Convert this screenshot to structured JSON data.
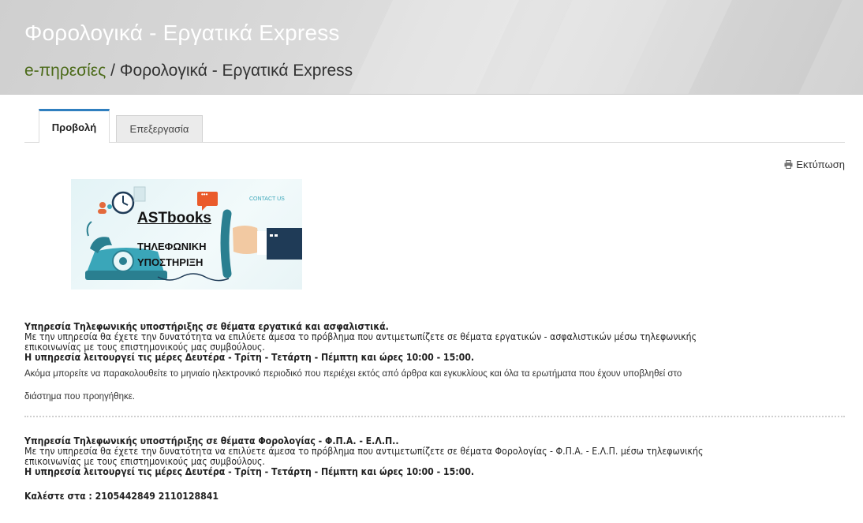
{
  "header": {
    "title": "Φορολογικά - Εργατικά Express",
    "breadcrumb": {
      "link": "e-πηρεσίες",
      "separator": "/",
      "current": "Φορολογικά - Εργατικά Express"
    }
  },
  "tabs": [
    {
      "label": "Προβολή",
      "active": true
    },
    {
      "label": "Επεξεργασία",
      "active": false
    }
  ],
  "print_label": "Εκτύπωση",
  "promo_image": {
    "contact_text": "CONTACT US",
    "brand": "ASTbooks",
    "line1": "ΤΗΛΕΦΩΝΙΚΗ",
    "line2": "ΥΠΟΣΤΗΡΙΞΗ",
    "badge": "•••"
  },
  "section1": {
    "heading": "Υπηρεσία Τηλεφωνικής υποστήριξης σε θέματα εργατικά και ασφαλιστικά.",
    "line1": "Με την υπηρεσία θα έχετε την δυνατότητα να επιλύετε άμεσα το πρόβλημα που αντιμετωπίζετε σε θέματα εργατικών - ασφαλιστικών μέσω τηλεφωνικής",
    "line2": "επικοινωνίας με τους επιστημονικούς μας συμβούλους.",
    "hours": "Η υπηρεσία λειτουργεί τις μέρες Δευτέρα - Τρίτη - Τετάρτη - Πέμπτη και ώρες 10:00 - 15:00.",
    "extra1": "Ακόμα μπορείτε να παρακολουθείτε το μηνιαίο ηλεκτρονικό περιοδικό που περιέχει εκτός από άρθρα και εγκυκλίους και όλα τα ερωτήματα που έχουν υποβληθεί στο",
    "extra2": "διάστημα που προηγήθηκε."
  },
  "section2": {
    "heading": "Υπηρεσία Τηλεφωνικής υποστήριξης σε θέματα Φορολογίας - Φ.Π.Α. - Ε.Λ.Π..",
    "line1": "Με την υπηρεσία θα έχετε την δυνατότητα να επιλύετε άμεσα το πρόβλημα που αντιμετωπίζετε σε θέματα Φορολογίας - Φ.Π.Α. - Ε.Λ.Π. μέσω τηλεφωνικής",
    "line2": "επικοινωνίας με τους επιστημονικούς μας συμβούλους.",
    "hours": "Η υπηρεσία λειτουργεί τις μέρες Δευτέρα - Τρίτη - Τετάρτη - Πέμπτη και ώρες 10:00 - 15:00."
  },
  "call": "Καλέστε στα : 2105442849 2110128841",
  "colors": {
    "tab_accent": "#2f7fbf",
    "breadcrumb_link": "#4c6b1a",
    "phone_teal": "#3aa6b9"
  },
  "icons": [
    "printer-icon",
    "clock-icon",
    "chat-bubble-icon",
    "telephone-icon",
    "handset-icon",
    "people-icon"
  ]
}
